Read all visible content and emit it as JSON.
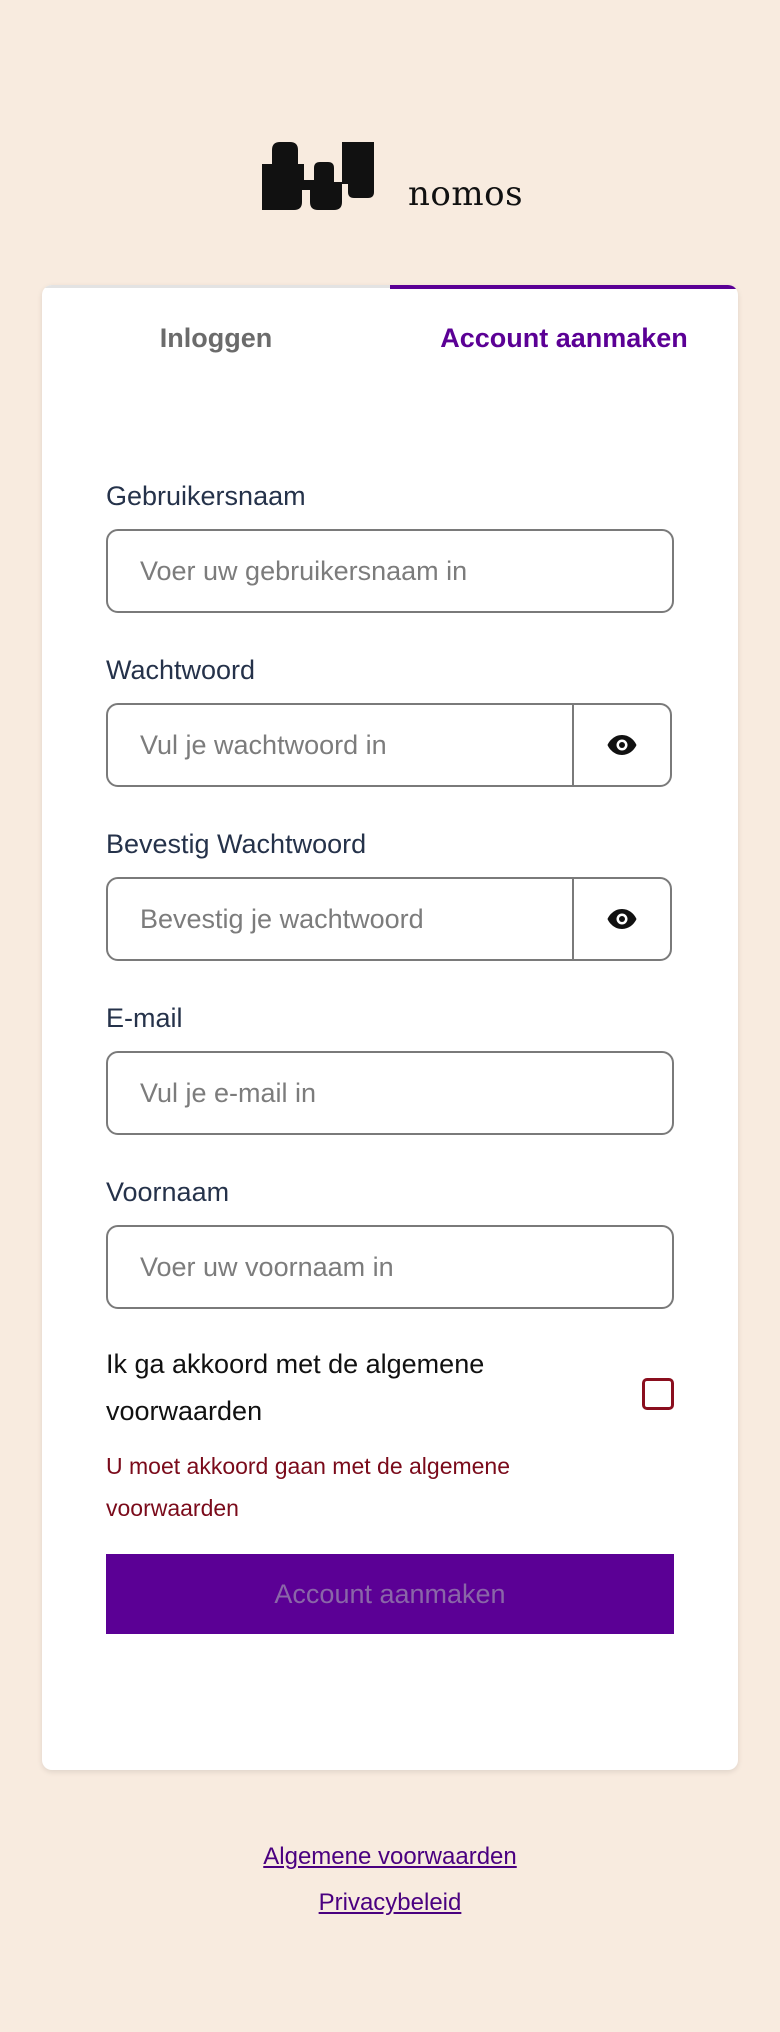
{
  "brand": {
    "name": "nomos",
    "logo_icon": "nomos-wave-logo-icon"
  },
  "tabs": [
    {
      "label": "Inloggen",
      "active": false
    },
    {
      "label": "Account aanmaken",
      "active": true
    }
  ],
  "form": {
    "username": {
      "label": "Gebruikersnaam",
      "placeholder": "Voer uw gebruikersnaam in",
      "value": ""
    },
    "password": {
      "label": "Wachtwoord",
      "placeholder": "Vul je wachtwoord in",
      "value": "",
      "toggle_icon": "eye-icon"
    },
    "confirm_password": {
      "label": "Bevestig Wachtwoord",
      "placeholder": "Bevestig je wachtwoord",
      "value": "",
      "toggle_icon": "eye-icon"
    },
    "email": {
      "label": "E-mail",
      "placeholder": "Vul je e-mail in",
      "value": ""
    },
    "first_name": {
      "label": "Voornaam",
      "placeholder": "Voer uw voornaam in",
      "value": ""
    },
    "terms": {
      "label": "Ik ga akkoord met de algemene voorwaarden",
      "checked": false,
      "error": "U moet akkoord gaan met de algemene voorwaarden"
    },
    "submit_label": "Account aanmaken"
  },
  "footer": {
    "links": [
      "Algemene voorwaarden",
      "Privacybeleid"
    ]
  },
  "colors": {
    "background": "#f8ebdf",
    "accent": "#5b0095",
    "error": "#7a0a1a"
  }
}
